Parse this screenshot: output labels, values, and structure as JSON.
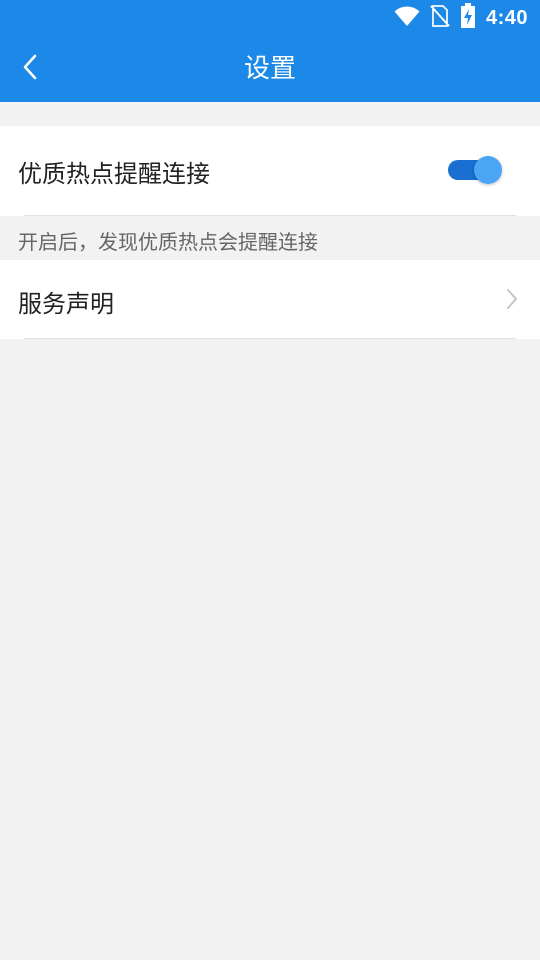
{
  "status_bar": {
    "time": "4:40",
    "icons": [
      "wifi-icon",
      "no-sim-icon",
      "battery-charging-icon"
    ]
  },
  "app_bar": {
    "back_icon": "chevron-left-icon",
    "title": "设置"
  },
  "settings": {
    "hotspot_reminder": {
      "label": "优质热点提醒连接",
      "enabled": true,
      "hint": "开启后，发现优质热点会提醒连接"
    },
    "service_statement": {
      "label": "服务声明",
      "icon": "chevron-right-icon"
    }
  },
  "colors": {
    "primary": "#1c88e8",
    "toggle_track": "#1a6fd0",
    "toggle_knob": "#4aa6f5",
    "background": "#f2f2f2"
  }
}
